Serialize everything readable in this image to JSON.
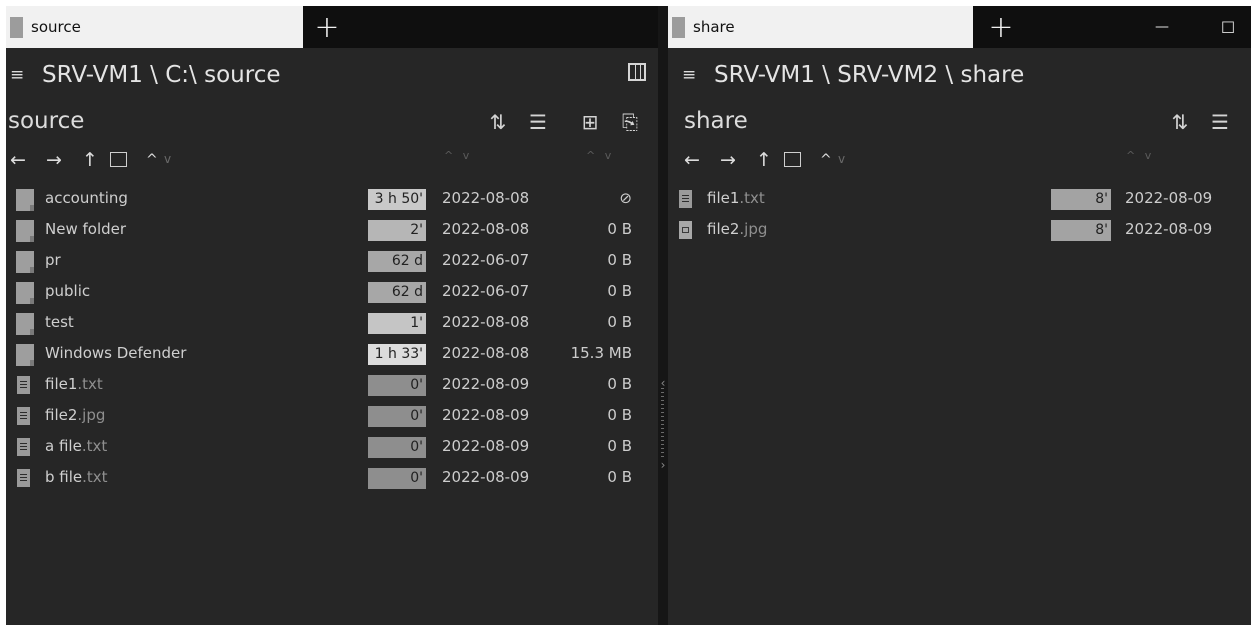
{
  "left_pane": {
    "tab_label": "source",
    "path": "SRV-VM1 \\ C:\\ source",
    "title": "source",
    "files": [
      {
        "name": "accounting",
        "ext": "",
        "type": "folder",
        "age": "3 h 50'",
        "date": "2022-08-08",
        "size": "⊘",
        "age_bg": "#c9c9c9"
      },
      {
        "name": "New folder",
        "ext": "",
        "type": "folder",
        "age": "2'",
        "date": "2022-08-08",
        "size": "0 B",
        "age_bg": "#b6b6b6"
      },
      {
        "name": "pr",
        "ext": "",
        "type": "folder",
        "age": "62 d",
        "date": "2022-06-07",
        "size": "0 B",
        "age_bg": "#a7a7a7"
      },
      {
        "name": "public",
        "ext": "",
        "type": "folder",
        "age": "62 d",
        "date": "2022-06-07",
        "size": "0 B",
        "age_bg": "#a7a7a7"
      },
      {
        "name": "test",
        "ext": "",
        "type": "folder",
        "age": "1'",
        "date": "2022-08-08",
        "size": "0 B",
        "age_bg": "#c5c5c5"
      },
      {
        "name": "Windows Defender",
        "ext": "",
        "type": "folder",
        "age": "1 h 33'",
        "date": "2022-08-08",
        "size": "15.3 MB",
        "age_bg": "#dcdcdc"
      },
      {
        "name": "file1",
        "ext": ".txt",
        "type": "text",
        "age": "0'",
        "date": "2022-08-09",
        "size": "0 B",
        "age_bg": "#8e8e8e"
      },
      {
        "name": "file2",
        "ext": ".jpg",
        "type": "text",
        "age": "0'",
        "date": "2022-08-09",
        "size": "0 B",
        "age_bg": "#8e8e8e"
      },
      {
        "name": "a file",
        "ext": ".txt",
        "type": "text",
        "age": "0'",
        "date": "2022-08-09",
        "size": "0 B",
        "age_bg": "#8e8e8e"
      },
      {
        "name": "b file",
        "ext": ".txt",
        "type": "text",
        "age": "0'",
        "date": "2022-08-09",
        "size": "0 B",
        "age_bg": "#8e8e8e"
      }
    ]
  },
  "right_pane": {
    "tab_label": "share",
    "path": "SRV-VM1 \\ SRV-VM2 \\ share",
    "title": "share",
    "files": [
      {
        "name": "file1",
        "ext": ".txt",
        "type": "text",
        "age": "8'",
        "date": "2022-08-09",
        "age_bg": "#a3a3a3"
      },
      {
        "name": "file2",
        "ext": ".jpg",
        "type": "image",
        "age": "8'",
        "date": "2022-08-09",
        "age_bg": "#a3a3a3"
      }
    ]
  },
  "icons": {
    "menu": "≡",
    "add_tab": "+",
    "back": "←",
    "forward": "→",
    "up": "↑",
    "collapse": "^",
    "expand": "v",
    "sort": "⇅",
    "list_view": "☰",
    "new_item": "⊞",
    "paste": "⎘",
    "minimize": "—",
    "maximize": "☐",
    "splitter_left": "‹",
    "splitter_right": "›"
  }
}
